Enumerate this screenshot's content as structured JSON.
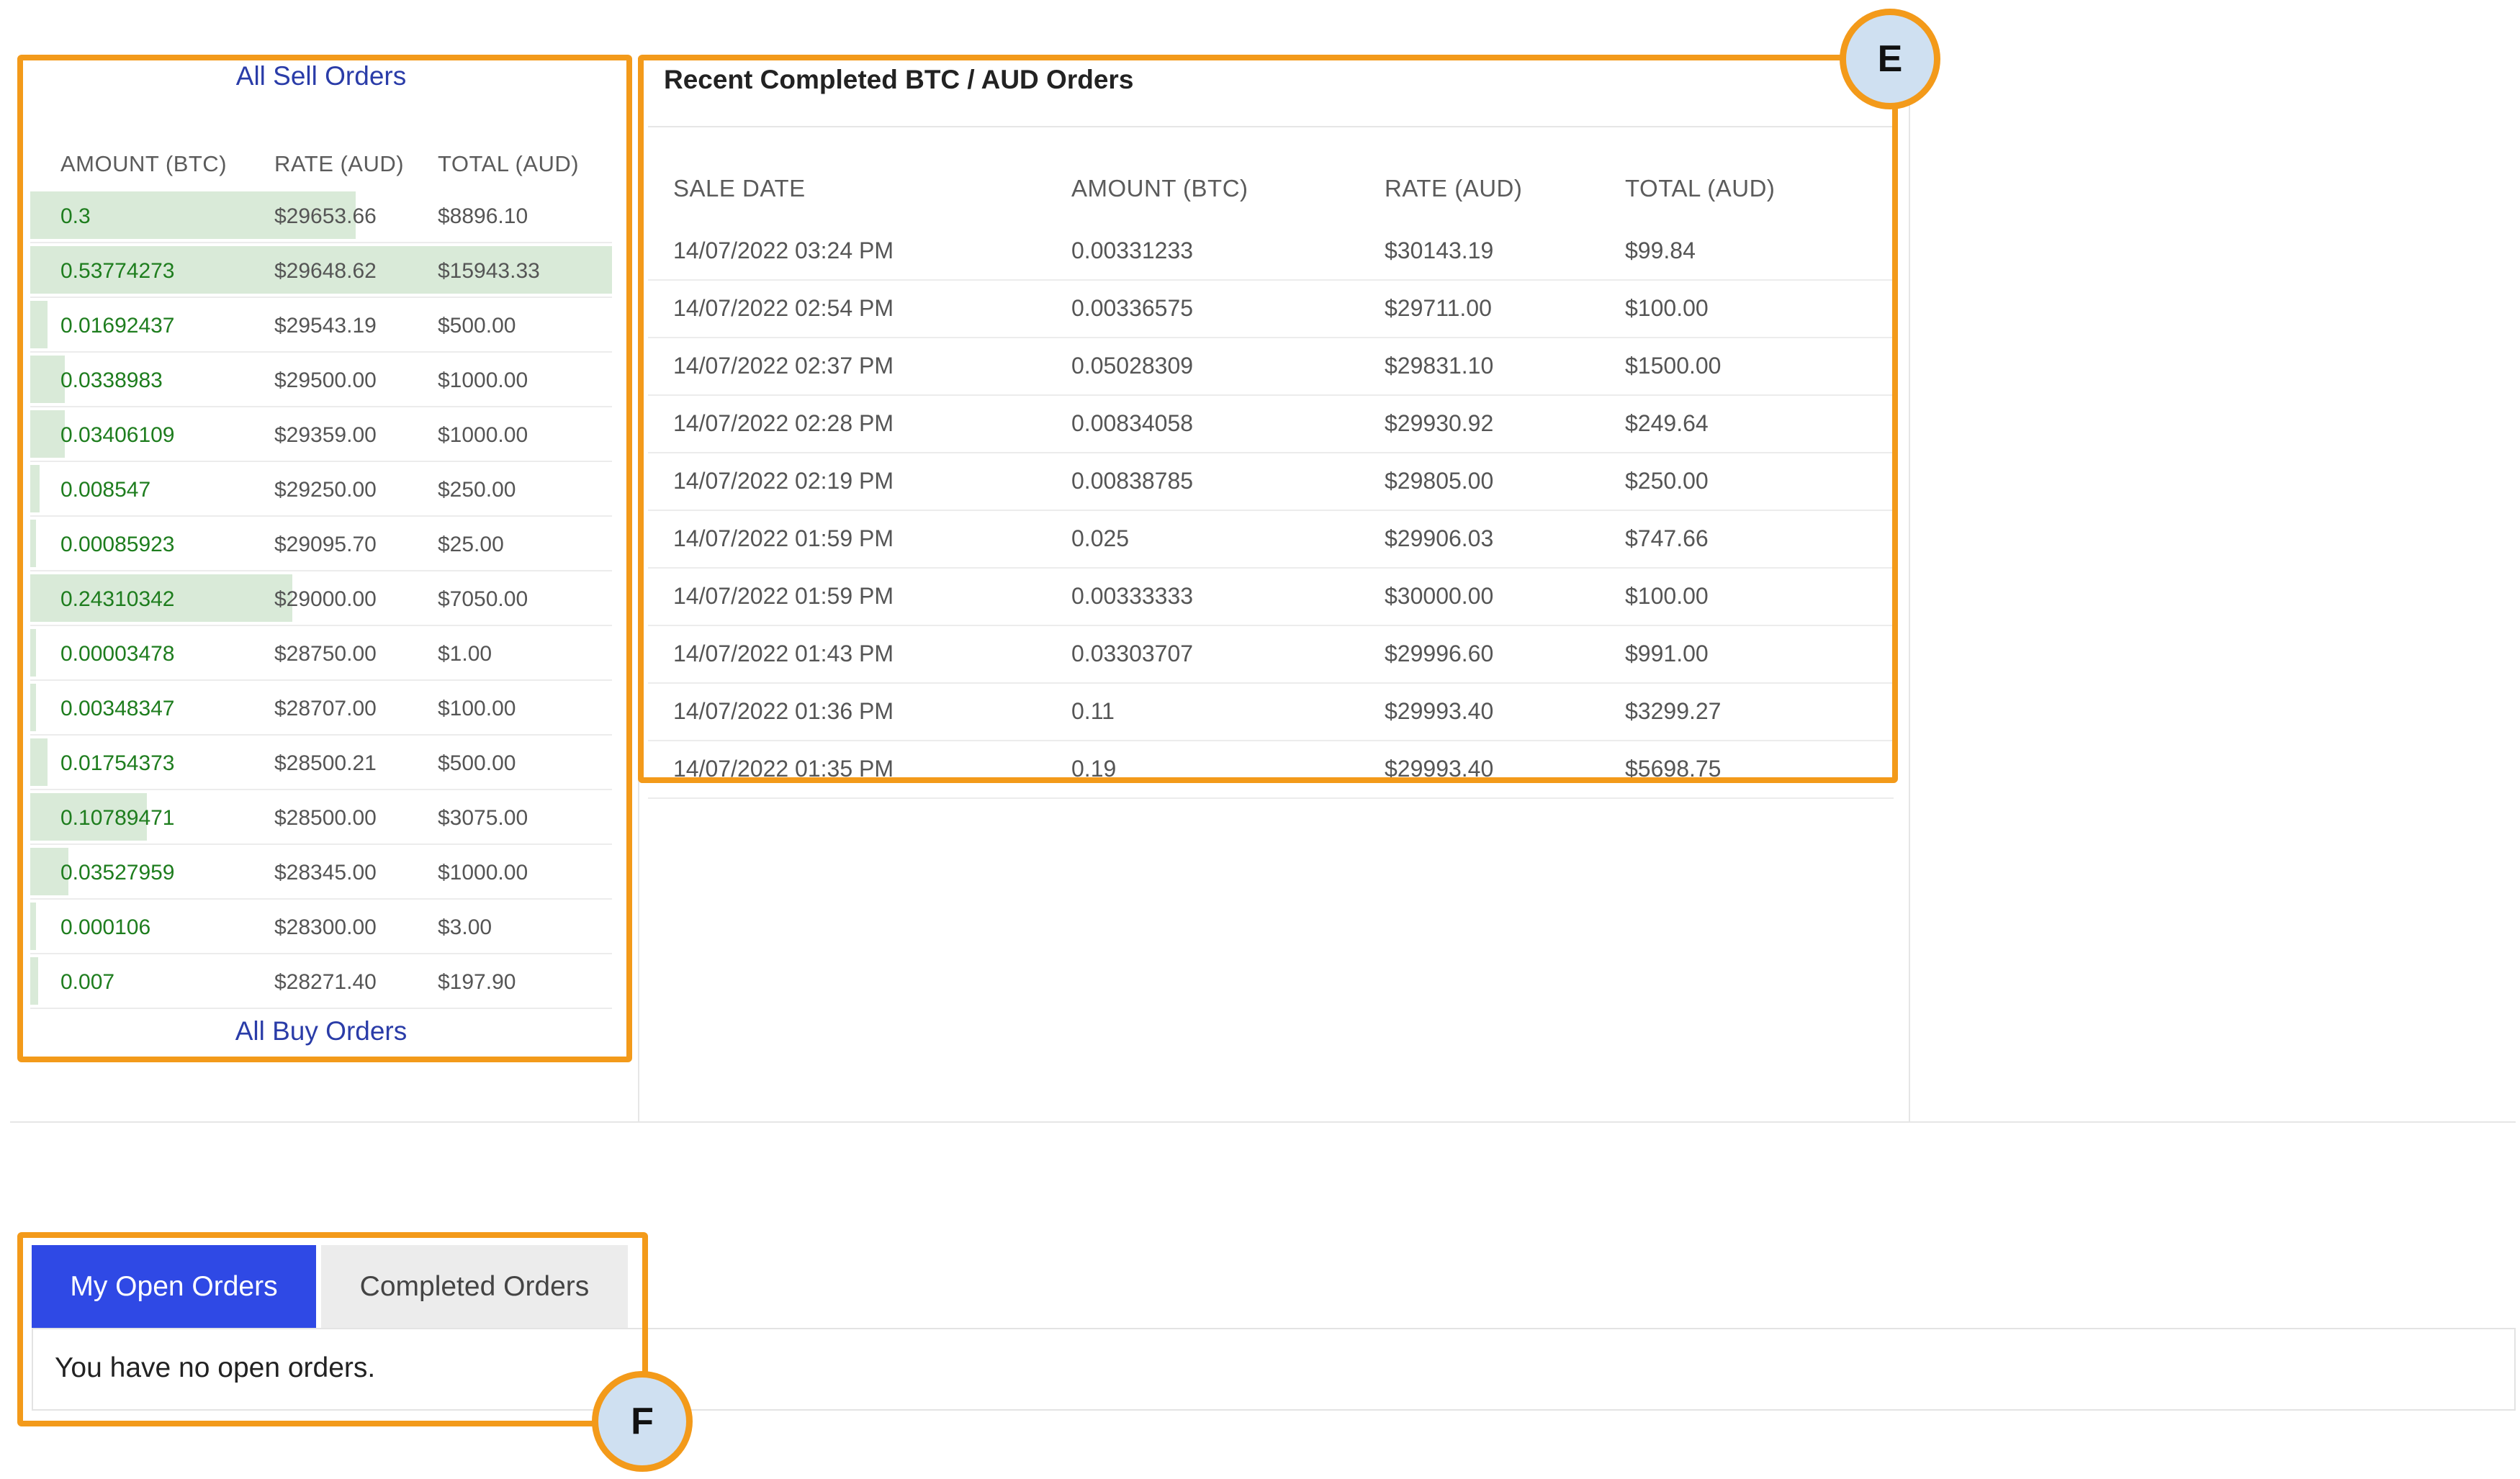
{
  "order_book": {
    "sell_link": "All Sell Orders",
    "buy_link": "All Buy Orders",
    "headers": [
      "AMOUNT (BTC)",
      "RATE (AUD)",
      "TOTAL (AUD)"
    ],
    "rows": [
      {
        "amount": "0.3",
        "rate": "$29653.66",
        "total": "$8896.10",
        "depth": 0.56
      },
      {
        "amount": "0.53774273",
        "rate": "$29648.62",
        "total": "$15943.33",
        "depth": 1.0
      },
      {
        "amount": "0.01692437",
        "rate": "$29543.19",
        "total": "$500.00",
        "depth": 0.03
      },
      {
        "amount": "0.0338983",
        "rate": "$29500.00",
        "total": "$1000.00",
        "depth": 0.06
      },
      {
        "amount": "0.03406109",
        "rate": "$29359.00",
        "total": "$1000.00",
        "depth": 0.06
      },
      {
        "amount": "0.008547",
        "rate": "$29250.00",
        "total": "$250.00",
        "depth": 0.016
      },
      {
        "amount": "0.00085923",
        "rate": "$29095.70",
        "total": "$25.00",
        "depth": 0.002
      },
      {
        "amount": "0.24310342",
        "rate": "$29000.00",
        "total": "$7050.00",
        "depth": 0.45
      },
      {
        "amount": "0.00003478",
        "rate": "$28750.00",
        "total": "$1.00",
        "depth": 0.0
      },
      {
        "amount": "0.00348347",
        "rate": "$28707.00",
        "total": "$100.00",
        "depth": 0.006
      },
      {
        "amount": "0.01754373",
        "rate": "$28500.21",
        "total": "$500.00",
        "depth": 0.03
      },
      {
        "amount": "0.10789471",
        "rate": "$28500.00",
        "total": "$3075.00",
        "depth": 0.2
      },
      {
        "amount": "0.03527959",
        "rate": "$28345.00",
        "total": "$1000.00",
        "depth": 0.065
      },
      {
        "amount": "0.000106",
        "rate": "$28300.00",
        "total": "$3.00",
        "depth": 0.0
      },
      {
        "amount": "0.007",
        "rate": "$28271.40",
        "total": "$197.90",
        "depth": 0.013
      }
    ]
  },
  "recent": {
    "title": "Recent Completed BTC / AUD Orders",
    "headers": [
      "SALE DATE",
      "AMOUNT (BTC)",
      "RATE (AUD)",
      "TOTAL (AUD)"
    ],
    "rows": [
      {
        "date": "14/07/2022 03:24 PM",
        "amount": "0.00331233",
        "rate": "$30143.19",
        "total": "$99.84"
      },
      {
        "date": "14/07/2022 02:54 PM",
        "amount": "0.00336575",
        "rate": "$29711.00",
        "total": "$100.00"
      },
      {
        "date": "14/07/2022 02:37 PM",
        "amount": "0.05028309",
        "rate": "$29831.10",
        "total": "$1500.00"
      },
      {
        "date": "14/07/2022 02:28 PM",
        "amount": "0.00834058",
        "rate": "$29930.92",
        "total": "$249.64"
      },
      {
        "date": "14/07/2022 02:19 PM",
        "amount": "0.00838785",
        "rate": "$29805.00",
        "total": "$250.00"
      },
      {
        "date": "14/07/2022 01:59 PM",
        "amount": "0.025",
        "rate": "$29906.03",
        "total": "$747.66"
      },
      {
        "date": "14/07/2022 01:59 PM",
        "amount": "0.00333333",
        "rate": "$30000.00",
        "total": "$100.00"
      },
      {
        "date": "14/07/2022 01:43 PM",
        "amount": "0.03303707",
        "rate": "$29996.60",
        "total": "$991.00"
      },
      {
        "date": "14/07/2022 01:36 PM",
        "amount": "0.11",
        "rate": "$29993.40",
        "total": "$3299.27"
      },
      {
        "date": "14/07/2022 01:35 PM",
        "amount": "0.19",
        "rate": "$29993.40",
        "total": "$5698.75"
      }
    ]
  },
  "tabs": {
    "open_label": "My Open Orders",
    "completed_label": "Completed Orders",
    "empty_message": "You have no open orders."
  },
  "annotations": {
    "marker_e": "E",
    "marker_f": "F"
  },
  "colors": {
    "highlight": "#f39a1a",
    "marker_fill": "#cfe0f1",
    "active_tab": "#2f49e5",
    "depth_bar": "#d9ead8",
    "amount_text": "#1e7d1e",
    "link_text": "#2a3ca8"
  }
}
